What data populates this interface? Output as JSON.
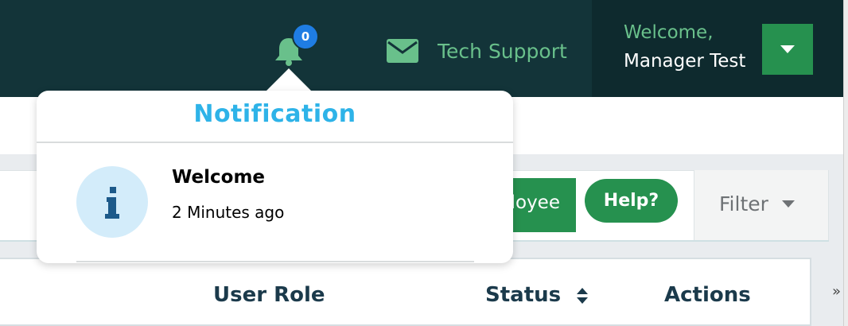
{
  "header": {
    "notification_count": "0",
    "support_label": "Tech Support",
    "welcome": "Welcome,",
    "user_name": "Manager Test"
  },
  "toolbar": {
    "employee_button_label": "Add Employee",
    "help_label": "Help?",
    "filter_label": "Filter"
  },
  "table": {
    "columns": [
      "User Role",
      "Status",
      "Actions"
    ]
  },
  "notification_popover": {
    "title": "Notification",
    "items": [
      {
        "title": "Welcome",
        "time": "2 Minutes ago",
        "icon": "info-icon"
      }
    ]
  },
  "colors": {
    "navbar": "#133439",
    "accent_green": "#26914f",
    "link_green": "#69c08b",
    "notification_title": "#2eb3e8",
    "badge": "#1f7de3",
    "header_text": "#1b3a4b"
  }
}
